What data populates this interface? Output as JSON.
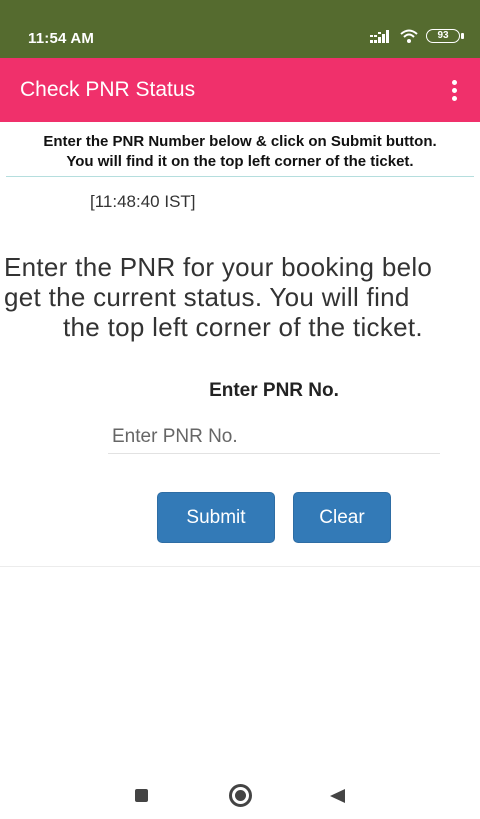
{
  "status_bar": {
    "time": "11:54 AM",
    "battery": "93",
    "icons": [
      "signal-icon",
      "wifi-icon",
      "battery-icon"
    ]
  },
  "app_bar": {
    "title": "Check PNR Status",
    "menu_icon": "more-vert-icon"
  },
  "instructions": {
    "line1": "Enter the PNR Number below & click on Submit button.",
    "line2": "You will find it on the top left corner of the ticket."
  },
  "timestamp": "[11:48:40 IST]",
  "message": {
    "line1": "Enter the PNR for your booking belo",
    "line2": "get the current status. You will find",
    "line3": "the top left corner of the ticket."
  },
  "form": {
    "label": "Enter PNR No.",
    "placeholder": "Enter PNR No.",
    "value": "",
    "submit_label": "Submit",
    "clear_label": "Clear"
  },
  "nav_bar": {
    "icons": [
      "recent-apps-icon",
      "home-icon",
      "back-icon"
    ]
  },
  "colors": {
    "status_bar": "#556b2f",
    "app_bar": "#f0306b",
    "button": "#337ab7"
  }
}
